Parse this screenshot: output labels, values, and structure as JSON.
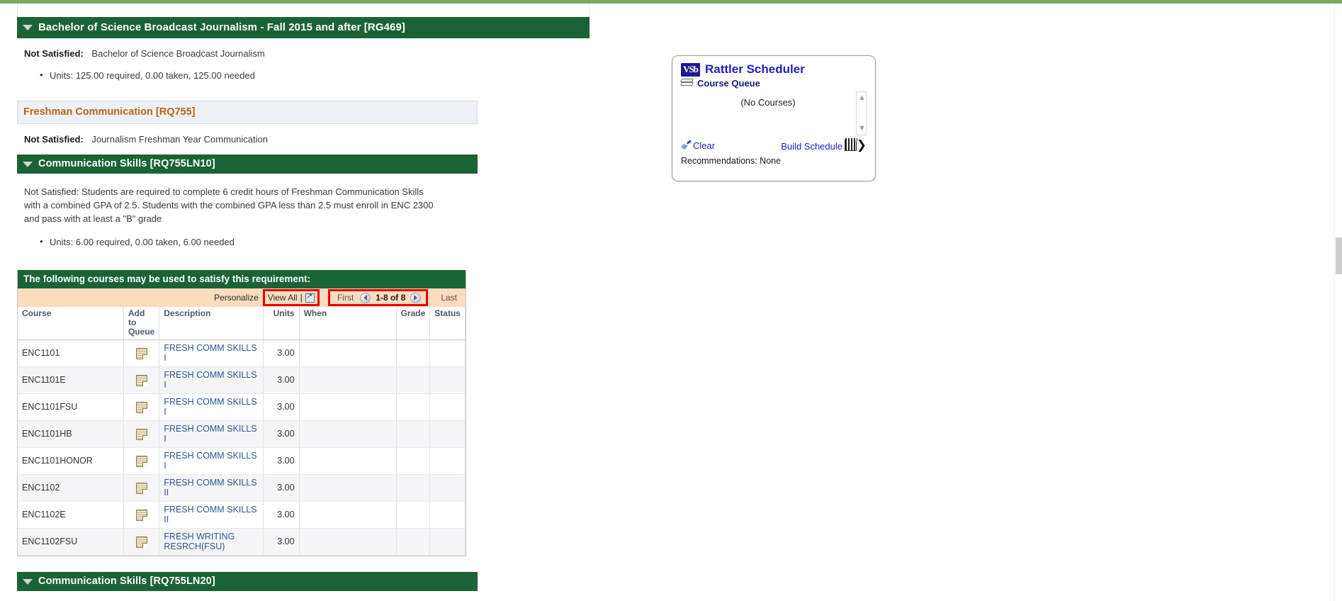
{
  "degree_group": {
    "header": "Bachelor of Science Broadcast Journalism - Fall 2015 and after [RG469]",
    "status_label": "Not Satisfied:",
    "status_text": "Bachelor of Science Broadcast Journalism",
    "units_line": "Units: 125.00 required, 0.00 taken, 125.00 needed"
  },
  "requirement": {
    "bar_title": "Freshman Communication [RQ755]",
    "status_label": "Not Satisfied:",
    "status_text": "Journalism Freshman Year Communication"
  },
  "line_10": {
    "header": "Communication Skills [RQ755LN10]",
    "status_label": "Not Satisfied:",
    "status_text": "Students are required to complete 6 credit hours of Freshman Communication Skills with a combined GPA of 2.5. Students with the combined GPA less than 2.5 must enroll in ENC 2300 and pass with at least a \"B\" grade",
    "units_line": "Units: 6.00 required, 0.00 taken, 6.00 needed"
  },
  "line_20": {
    "header": "Communication Skills [RQ755LN20]"
  },
  "course_table": {
    "title": "The following courses may be used to satisfy this requirement:",
    "personalize": "Personalize",
    "view_all": "View All",
    "separator": "|",
    "popout_icon": "popout-icon",
    "first": "First",
    "last": "Last",
    "range": "1-8 of 8",
    "prev_icon": "left-arrow-icon",
    "next_icon": "right-arrow-icon",
    "columns": [
      "Course",
      "Add to Queue",
      "Description",
      "Units",
      "When",
      "Grade",
      "Status"
    ],
    "rows": [
      {
        "course": "ENC1101",
        "add": "add-to-queue-icon",
        "description": "FRESH COMM SKILLS I",
        "units": "3.00",
        "when": "",
        "grade": "",
        "status": ""
      },
      {
        "course": "ENC1101E",
        "add": "add-to-queue-icon",
        "description": "FRESH COMM SKILLS I",
        "units": "3.00",
        "when": "",
        "grade": "",
        "status": ""
      },
      {
        "course": "ENC1101FSU",
        "add": "add-to-queue-icon",
        "description": "FRESH COMM SKILLS I",
        "units": "3.00",
        "when": "",
        "grade": "",
        "status": ""
      },
      {
        "course": "ENC1101HB",
        "add": "add-to-queue-icon",
        "description": "FRESH COMM SKILLS I",
        "units": "3.00",
        "when": "",
        "grade": "",
        "status": ""
      },
      {
        "course": "ENC1101HONOR",
        "add": "add-to-queue-icon",
        "description": "FRESH COMM SKILLS I",
        "units": "3.00",
        "when": "",
        "grade": "",
        "status": ""
      },
      {
        "course": "ENC1102",
        "add": "add-to-queue-icon",
        "description": "FRESH COMM SKILLS II",
        "units": "3.00",
        "when": "",
        "grade": "",
        "status": ""
      },
      {
        "course": "ENC1102E",
        "add": "add-to-queue-icon",
        "description": "FRESH COMM SKILLS II",
        "units": "3.00",
        "when": "",
        "grade": "",
        "status": ""
      },
      {
        "course": "ENC1102FSU",
        "add": "add-to-queue-icon",
        "description": "FRESH WRITING RESRCH(FSU)",
        "units": "3.00",
        "when": "",
        "grade": "",
        "status": ""
      }
    ]
  },
  "scheduler": {
    "logo_text": "VSb",
    "title": "Rattler Scheduler",
    "queue_label": "Course Queue",
    "queue_empty": "(No Courses)",
    "clear_label": "Clear",
    "build_label": "Build Schedule",
    "calendar_icon": "calendar-icon",
    "chevron_icon": "chevron-right-icon",
    "recommendations": "Recommendations: None",
    "scroll_up_icon": "chevron-up-icon",
    "scroll_down_icon": "chevron-down-icon"
  },
  "colors": {
    "header_green": "#1a6334",
    "top_strip_green": "#7aa86a",
    "nav_peach": "#fbdcbf",
    "highlight_red": "#e60000",
    "link_blue": "#2b5797",
    "req_orange": "#b5651d",
    "scheduler_blue": "#2020c0"
  }
}
